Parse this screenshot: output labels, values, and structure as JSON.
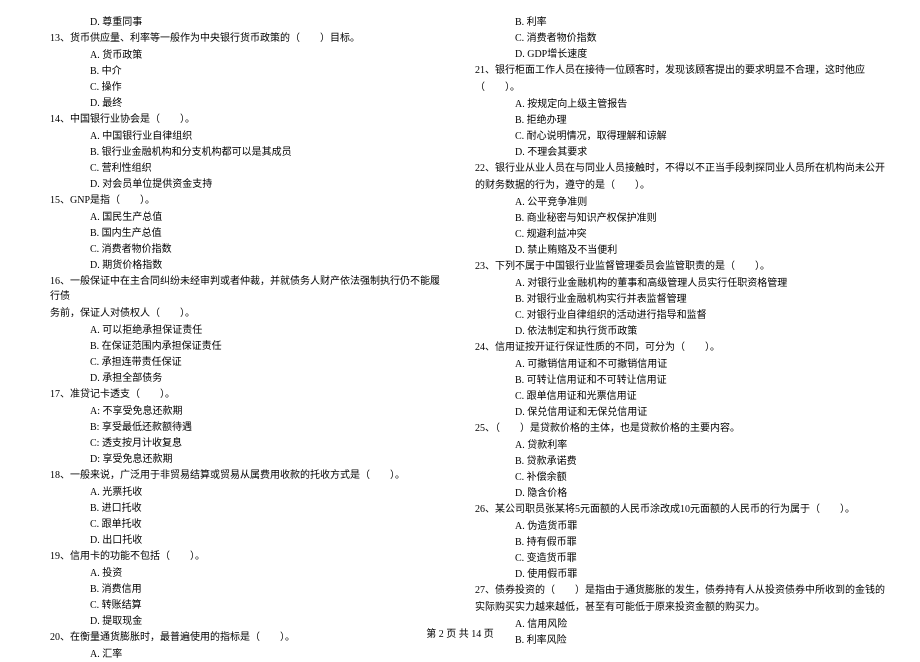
{
  "col1": {
    "d_option_top": "D. 尊重同事",
    "q13": "13、货币供应量、利率等一般作为中央银行货币政策的（　　）目标。",
    "q13_a": "A. 货币政策",
    "q13_b": "B. 中介",
    "q13_c": "C. 操作",
    "q13_d": "D. 最终",
    "q14": "14、中国银行业协会是（　　）。",
    "q14_a": "A. 中国银行业自律组织",
    "q14_b": "B. 银行业金融机构和分支机构都可以是其成员",
    "q14_c": "C. 营利性组织",
    "q14_d": "D. 对会员单位提供资金支持",
    "q15": "15、GNP是指（　　）。",
    "q15_a": "A. 国民生产总值",
    "q15_b": "B. 国内生产总值",
    "q15_c": "C. 消费者物价指数",
    "q15_d": "D. 期货价格指数",
    "q16": "16、一般保证中在主合同纠纷未经审判或者仲裁，并就债务人财产依法强制执行仍不能履行债",
    "q16_cont": "务前，保证人对债权人（　　）。",
    "q16_a": "A. 可以拒绝承担保证责任",
    "q16_b": "B. 在保证范围内承担保证责任",
    "q16_c": "C. 承担连带责任保证",
    "q16_d": "D. 承担全部债务",
    "q17": "17、准贷记卡透支（　　）。",
    "q17_a": "A: 不享受免息还款期",
    "q17_b": "B: 享受最低还款额待遇",
    "q17_c": "C: 透支按月计收复息",
    "q17_d": "D: 享受免息还款期",
    "q18": "18、一般来说，广泛用于非贸易结算或贸易从属费用收款的托收方式是（　　）。",
    "q18_a": "A. 光票托收",
    "q18_b": "B. 进口托收",
    "q18_c": "C. 跟单托收",
    "q18_d": "D. 出口托收",
    "q19": "19、信用卡的功能不包括（　　）。",
    "q19_a": "A. 投资",
    "q19_b": "B. 消费信用",
    "q19_c": "C. 转账结算",
    "q19_d": "D. 提取现金",
    "q20": "20、在衡量通货膨胀时，最普遍使用的指标是（　　）。",
    "q20_a": "A. 汇率"
  },
  "col2": {
    "q20_b": "B. 利率",
    "q20_c": "C. 消费者物价指数",
    "q20_d": "D. GDP增长速度",
    "q21": "21、银行柜面工作人员在接待一位顾客时，发现该顾客提出的要求明显不合理，这时他应",
    "q21_cont": "（　　）。",
    "q21_a": "A. 按规定向上级主管报告",
    "q21_b": "B. 拒绝办理",
    "q21_c": "C. 耐心说明情况，取得理解和谅解",
    "q21_d": "D. 不理会其要求",
    "q22": "22、银行业从业人员在与同业人员接触时，不得以不正当手段刺探同业人员所在机构尚未公开",
    "q22_cont": "的财务数据的行为，遵守的是（　　）。",
    "q22_a": "A. 公平竞争准则",
    "q22_b": "B. 商业秘密与知识产权保护准则",
    "q22_c": "C. 规避利益冲突",
    "q22_d": "D. 禁止贿赂及不当便利",
    "q23": "23、下列不属于中国银行业监督管理委员会监管职责的是（　　）。",
    "q23_a": "A. 对银行业金融机构的董事和高级管理人员实行任职资格管理",
    "q23_b": "B. 对银行业金融机构实行并表监督管理",
    "q23_c": "C. 对银行业自律组织的活动进行指导和监督",
    "q23_d": "D. 依法制定和执行货币政策",
    "q24": "24、信用证按开证行保证性质的不同，可分为（　　）。",
    "q24_a": "A. 可撤销信用证和不可撤销信用证",
    "q24_b": "B. 可转让信用证和不可转让信用证",
    "q24_c": "C. 跟单信用证和光票信用证",
    "q24_d": "D. 保兑信用证和无保兑信用证",
    "q25": "25、（　　）是贷款价格的主体，也是贷款价格的主要内容。",
    "q25_a": "A. 贷款利率",
    "q25_b": "B. 贷款承诺费",
    "q25_c": "C. 补偿余额",
    "q25_d": "D. 隐含价格",
    "q26": "26、某公司职员张某将5元面额的人民币涂改成10元面额的人民币的行为属于（　　）。",
    "q26_a": "A. 伪造货币罪",
    "q26_b": "B. 持有假币罪",
    "q26_c": "C. 变造货币罪",
    "q26_d": "D. 使用假币罪",
    "q27": "27、债券投资的（　　）是指由于通货膨胀的发生，债券持有人从投资债券中所收到的金钱的",
    "q27_cont": "实际购买实力越来越低，甚至有可能低于原来投资金额的购买力。",
    "q27_a": "A. 信用风险",
    "q27_b": "B. 利率风险"
  },
  "footer": "第 2 页 共 14 页"
}
